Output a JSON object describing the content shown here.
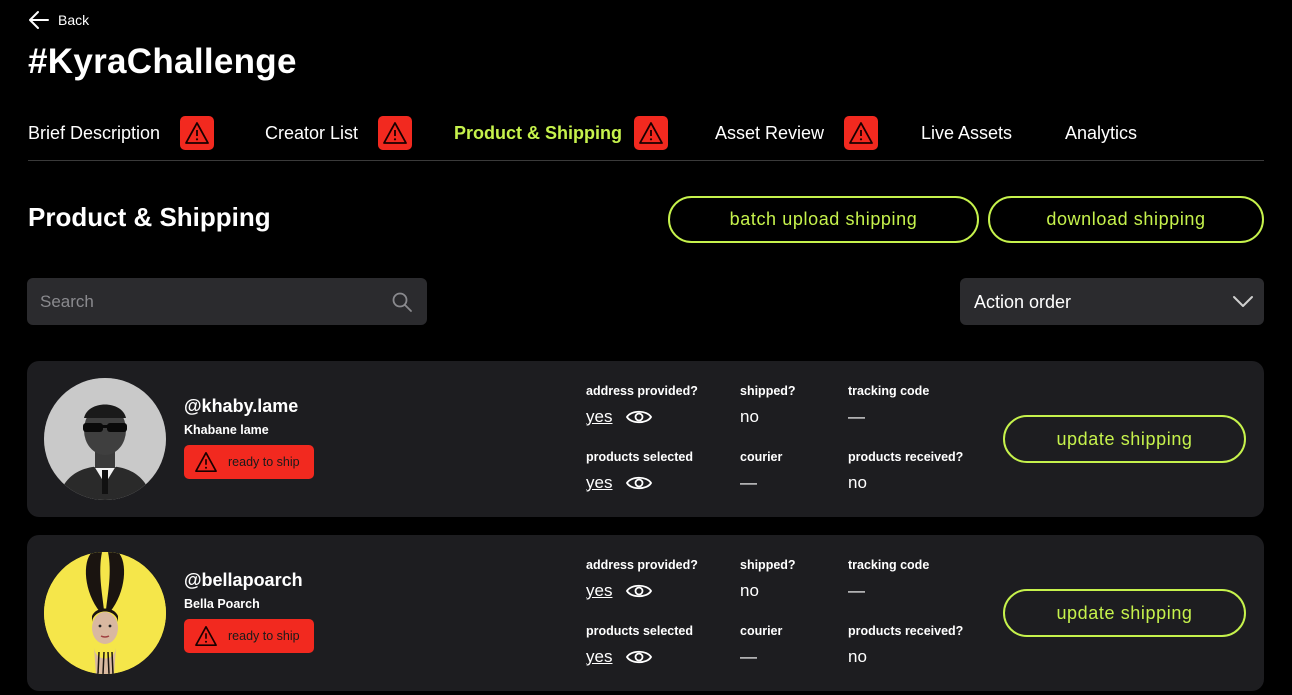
{
  "nav": {
    "back_label": "Back"
  },
  "page_title": "#KyraChallenge",
  "tabs": [
    {
      "label": "Brief Description",
      "warning": true,
      "active": false
    },
    {
      "label": "Creator List",
      "warning": true,
      "active": false
    },
    {
      "label": "Product & Shipping",
      "warning": true,
      "active": true
    },
    {
      "label": "Asset Review",
      "warning": true,
      "active": false
    },
    {
      "label": "Live Assets",
      "warning": false,
      "active": false
    },
    {
      "label": "Analytics",
      "warning": false,
      "active": false
    }
  ],
  "section": {
    "title": "Product & Shipping",
    "batch_upload_label": "batch upload shipping",
    "download_label": "download shipping"
  },
  "search": {
    "placeholder": "Search"
  },
  "sort": {
    "selected": "Action order"
  },
  "field_labels": {
    "address": "address provided?",
    "shipped": "shipped?",
    "tracking": "tracking code",
    "products_selected": "products selected",
    "courier": "courier",
    "products_received": "products received?"
  },
  "creators": [
    {
      "handle": "@khaby.lame",
      "name": "Khabane lame",
      "status": "ready to ship",
      "address": "yes",
      "shipped": "no",
      "tracking": "—",
      "products_selected": "yes",
      "courier": "—",
      "products_received": "no",
      "action_label": "update shipping"
    },
    {
      "handle": "@bellapoarch",
      "name": "Bella Poarch",
      "status": "ready to ship",
      "address": "yes",
      "shipped": "no",
      "tracking": "—",
      "products_selected": "yes",
      "courier": "—",
      "products_received": "no",
      "action_label": "update shipping"
    }
  ],
  "colors": {
    "accent": "#c6f24c",
    "warning": "#f2291f",
    "card": "#1d1d20",
    "input": "#2b2b2e"
  },
  "icons": {
    "back": "arrow-left-icon",
    "warning": "warning-triangle-icon",
    "search": "search-icon",
    "dropdown": "chevron-down-icon",
    "view": "eye-icon"
  }
}
